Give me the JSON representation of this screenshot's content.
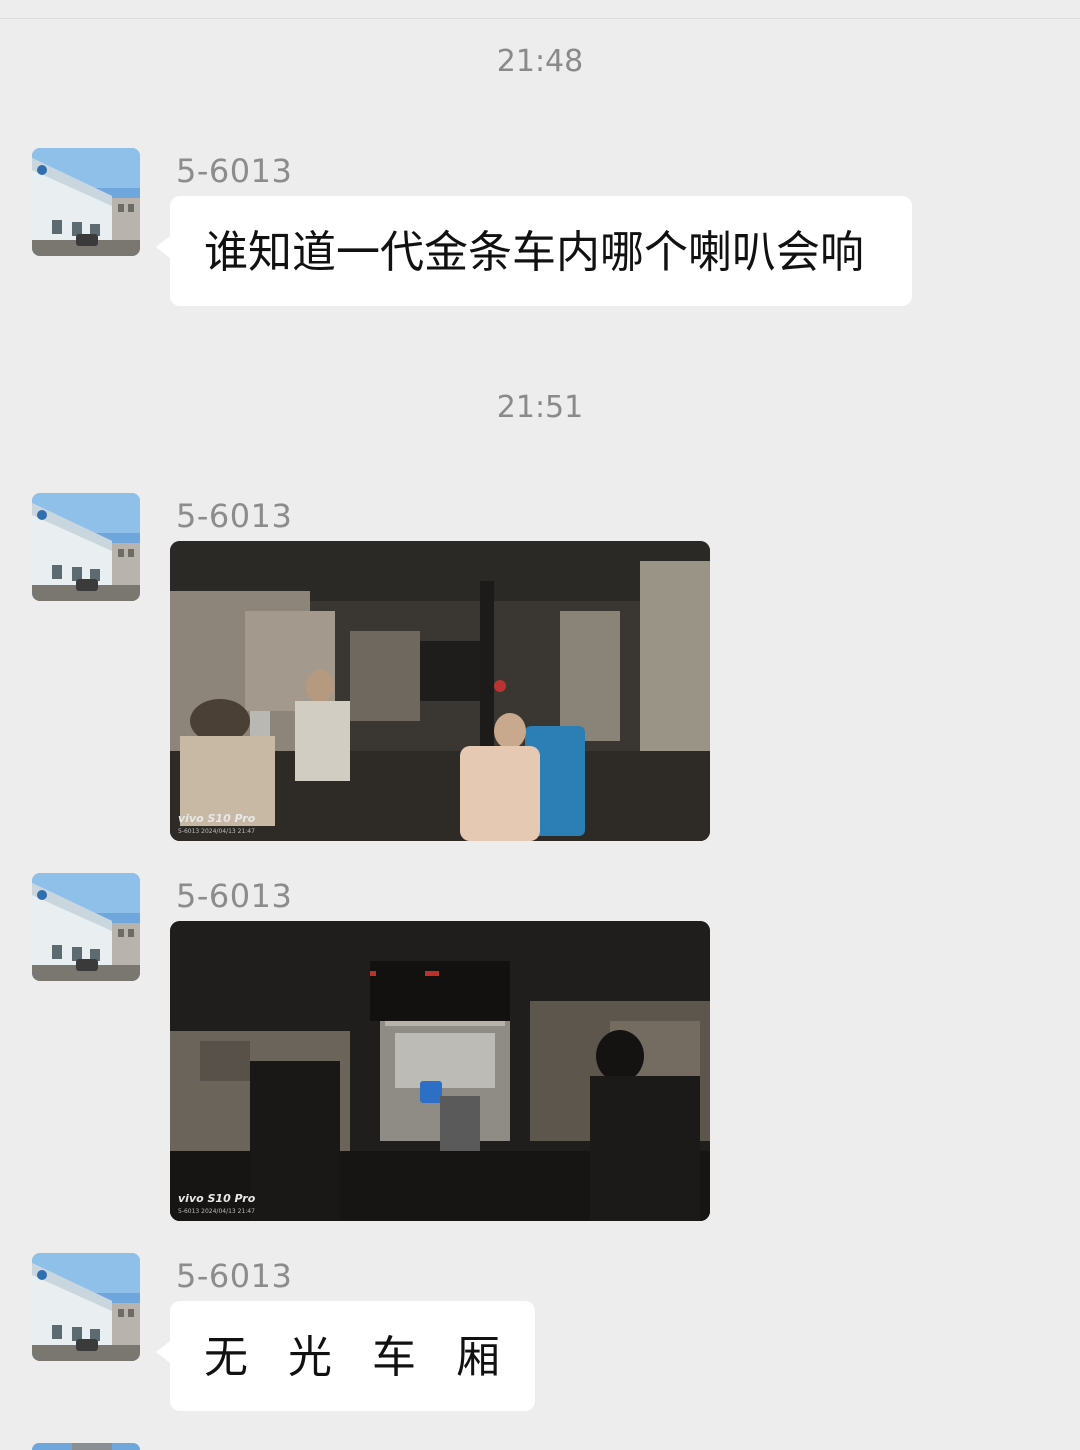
{
  "chat": {
    "timestamps": [
      "21:48",
      "21:51"
    ],
    "messages": [
      {
        "sender": "5-6013",
        "type": "text",
        "text": "谁知道一代金条车内哪个喇叭会响"
      },
      {
        "sender": "5-6013",
        "type": "image",
        "image": "bus-interior-photo",
        "watermark": "vivo S10 Pro",
        "watermark_detail": "5-6013 2024/04/13 21:47"
      },
      {
        "sender": "5-6013",
        "type": "image",
        "image": "bus-dark-interior-photo",
        "watermark": "vivo S10 Pro",
        "watermark_detail": "5-6013 2024/04/13 21:47"
      },
      {
        "sender": "5-6013",
        "type": "text",
        "text": "无光车厢"
      }
    ]
  },
  "colors": {
    "background": "#ededed",
    "bubble": "#ffffff",
    "timestamp": "#8a8a8a",
    "sender": "#8c8c8c"
  }
}
